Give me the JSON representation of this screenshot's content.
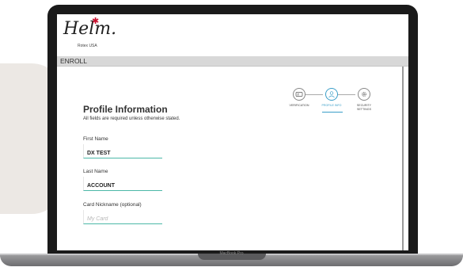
{
  "logo": {
    "wordmark": "Helm.",
    "sub": "Rotex USA"
  },
  "enroll": {
    "title": "ENROLL"
  },
  "form": {
    "title": "Profile Information",
    "subtitle": "All fields are required unless otherwise stated.",
    "first_name_label": "First Name",
    "first_name_value": "DX TEST",
    "last_name_label": "Last Name",
    "last_name_value": "ACCOUNT",
    "nickname_label": "Card Nickname (optional)",
    "nickname_placeholder": "My Card"
  },
  "steps": [
    {
      "label": "VERIFICATION",
      "icon": "id-card-icon",
      "active": false
    },
    {
      "label": "PROFILE INFO",
      "icon": "user-icon",
      "active": true
    },
    {
      "label": "SECURITY SETTINGS",
      "icon": "gear-icon",
      "active": false
    }
  ],
  "device": {
    "model": "MacBook Pro"
  },
  "colors": {
    "accent": "#3a9ec8",
    "field_border": "#4cb8a8",
    "brand_star": "#c8102e"
  }
}
